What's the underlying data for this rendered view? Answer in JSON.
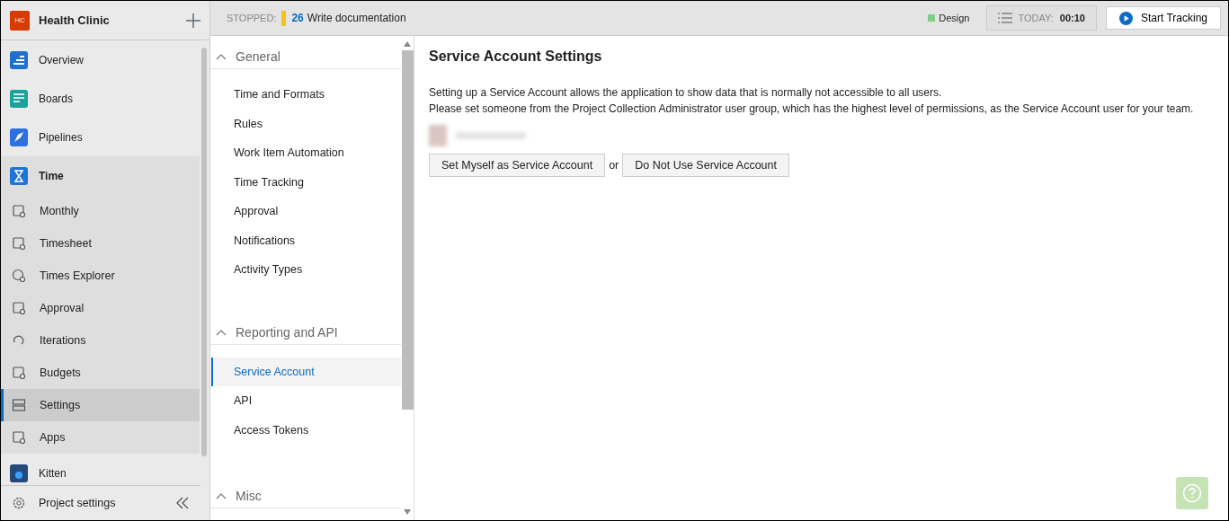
{
  "sidebar": {
    "org": {
      "initials": "HC",
      "name": "Health Clinic"
    },
    "items": [
      {
        "label": "Overview",
        "selected": false
      },
      {
        "label": "Boards",
        "selected": false
      },
      {
        "label": "Pipelines",
        "selected": false
      },
      {
        "label": "Time",
        "selected": false,
        "expanded": true,
        "children": [
          {
            "label": "Monthly",
            "selected": false
          },
          {
            "label": "Timesheet",
            "selected": false
          },
          {
            "label": "Times Explorer",
            "selected": false
          },
          {
            "label": "Approval",
            "selected": false
          },
          {
            "label": "Iterations",
            "selected": false
          },
          {
            "label": "Budgets",
            "selected": false
          },
          {
            "label": "Settings",
            "selected": true
          },
          {
            "label": "Apps",
            "selected": false
          }
        ]
      },
      {
        "label": "Kitten",
        "selected": false
      }
    ],
    "footer": {
      "label": "Project settings"
    }
  },
  "top_bar": {
    "status_label": "STOPPED:",
    "task_number": "26",
    "task_title": "Write documentation",
    "activity": {
      "label": "Design",
      "color": "#7fcf8a"
    },
    "today": {
      "label": "TODAY:",
      "value": "00:10"
    },
    "start_button": "Start Tracking"
  },
  "settings_nav": [
    {
      "title": "General",
      "expanded": true,
      "items": [
        {
          "label": "Time and Formats",
          "selected": false
        },
        {
          "label": "Rules",
          "selected": false
        },
        {
          "label": "Work Item Automation",
          "selected": false
        },
        {
          "label": "Time Tracking",
          "selected": false
        },
        {
          "label": "Approval",
          "selected": false
        },
        {
          "label": "Notifications",
          "selected": false
        },
        {
          "label": "Activity Types",
          "selected": false
        }
      ]
    },
    {
      "title": "Reporting and API",
      "expanded": true,
      "items": [
        {
          "label": "Service Account",
          "selected": true
        },
        {
          "label": "API",
          "selected": false
        },
        {
          "label": "Access Tokens",
          "selected": false
        }
      ]
    },
    {
      "title": "Misc",
      "expanded": true
    }
  ],
  "content": {
    "title": "Service Account Settings",
    "paragraphs": [
      "Setting up a Service Account allows the application to show data that is normally not accessible to all users.",
      "Please set someone from the Project Collection Administrator user group, which has the highest level of permissions, as the Service Account user for your team."
    ],
    "buttons": [
      "Set Myself as Service Account",
      "Do Not Use Service Account"
    ],
    "separator": "or"
  }
}
